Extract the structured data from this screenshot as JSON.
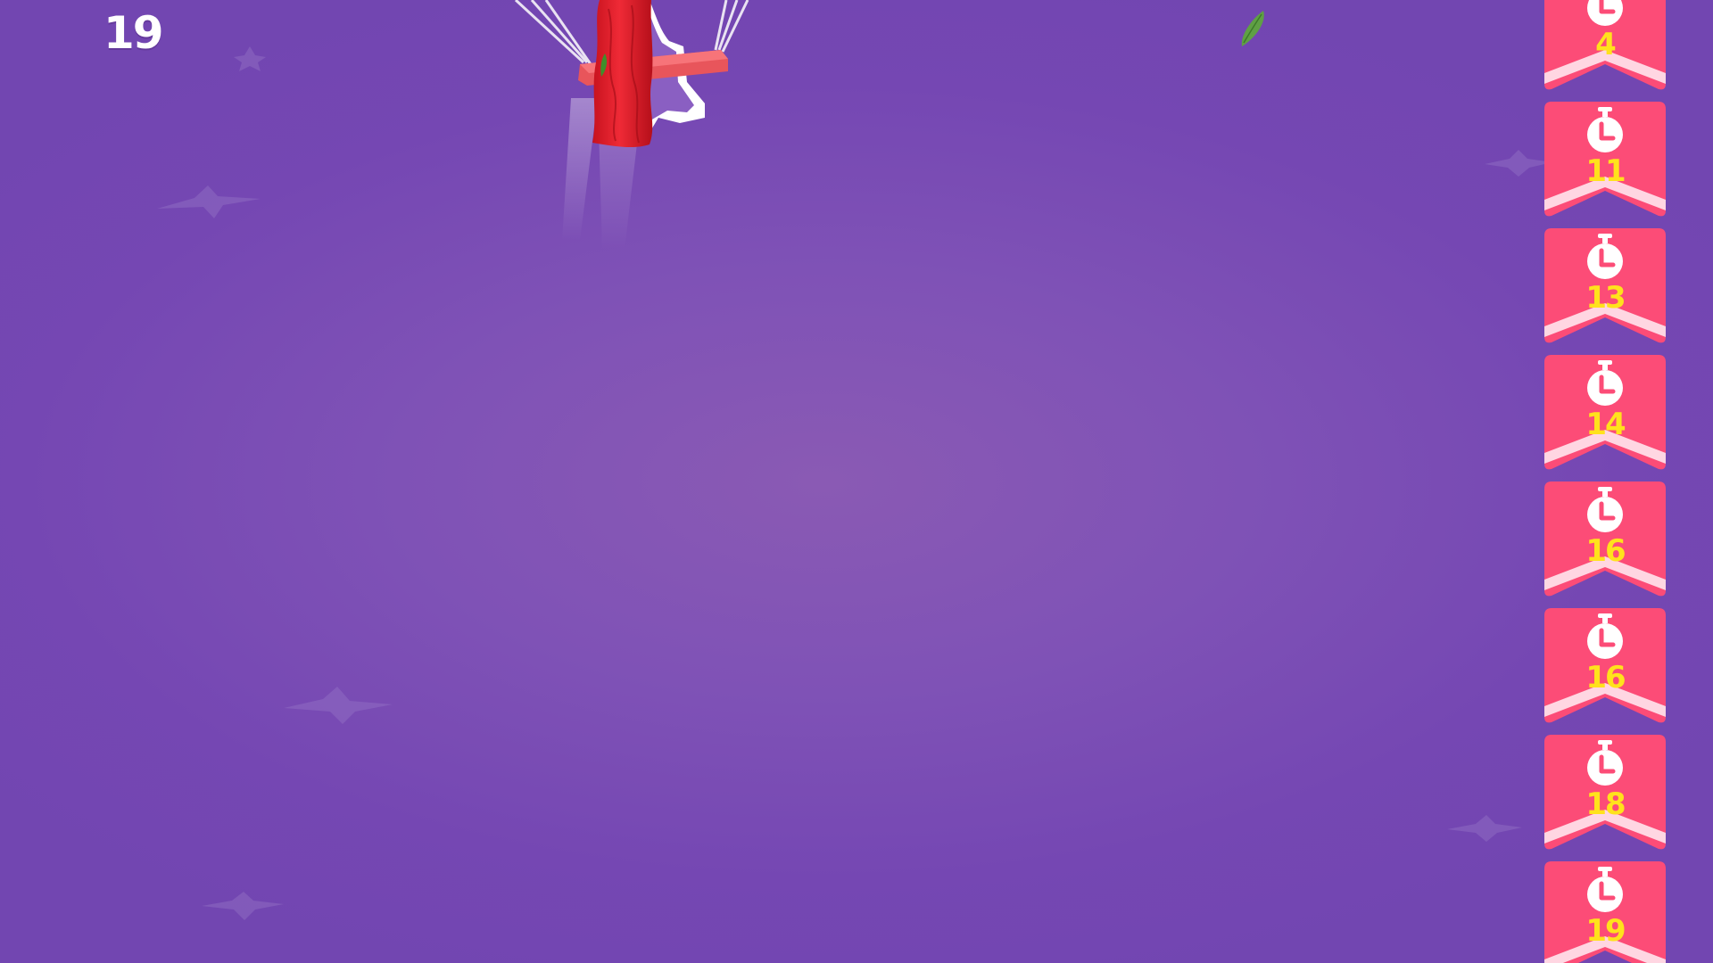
{
  "hud": {
    "score": "19"
  },
  "timer_cards": [
    {
      "value": "4"
    },
    {
      "value": "11"
    },
    {
      "value": "13"
    },
    {
      "value": "14"
    },
    {
      "value": "16"
    },
    {
      "value": "16"
    },
    {
      "value": "18"
    },
    {
      "value": "19"
    }
  ],
  "icons": {
    "timer": "stopwatch-icon",
    "decoration": "star-icon"
  },
  "colors": {
    "background": "#7a4cb4",
    "card": "#fc4c77",
    "card_chevron": "#ffd6e2",
    "timer_text": "#ffe21c",
    "score_text": "#ffffff",
    "player_body": "#e31e2c",
    "glider": "#f05a5e"
  }
}
